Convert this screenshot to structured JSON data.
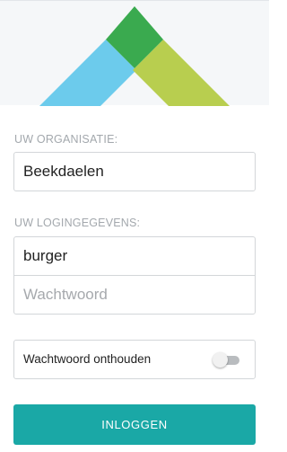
{
  "organization": {
    "label": "UW ORGANISATIE:",
    "value": "Beekdaelen"
  },
  "credentials": {
    "label": "UW LOGINGEGEVENS:",
    "username_value": "burger",
    "password_placeholder": "Wachtwoord"
  },
  "remember": {
    "label": "Wachtwoord onthouden",
    "enabled": false
  },
  "login_button": {
    "label": "INLOGGEN"
  },
  "colors": {
    "accent": "#1aa8a6",
    "logo_blue": "#6ccbec",
    "logo_green": "#b8ce4f",
    "logo_dark_green": "#3aaa4f"
  }
}
